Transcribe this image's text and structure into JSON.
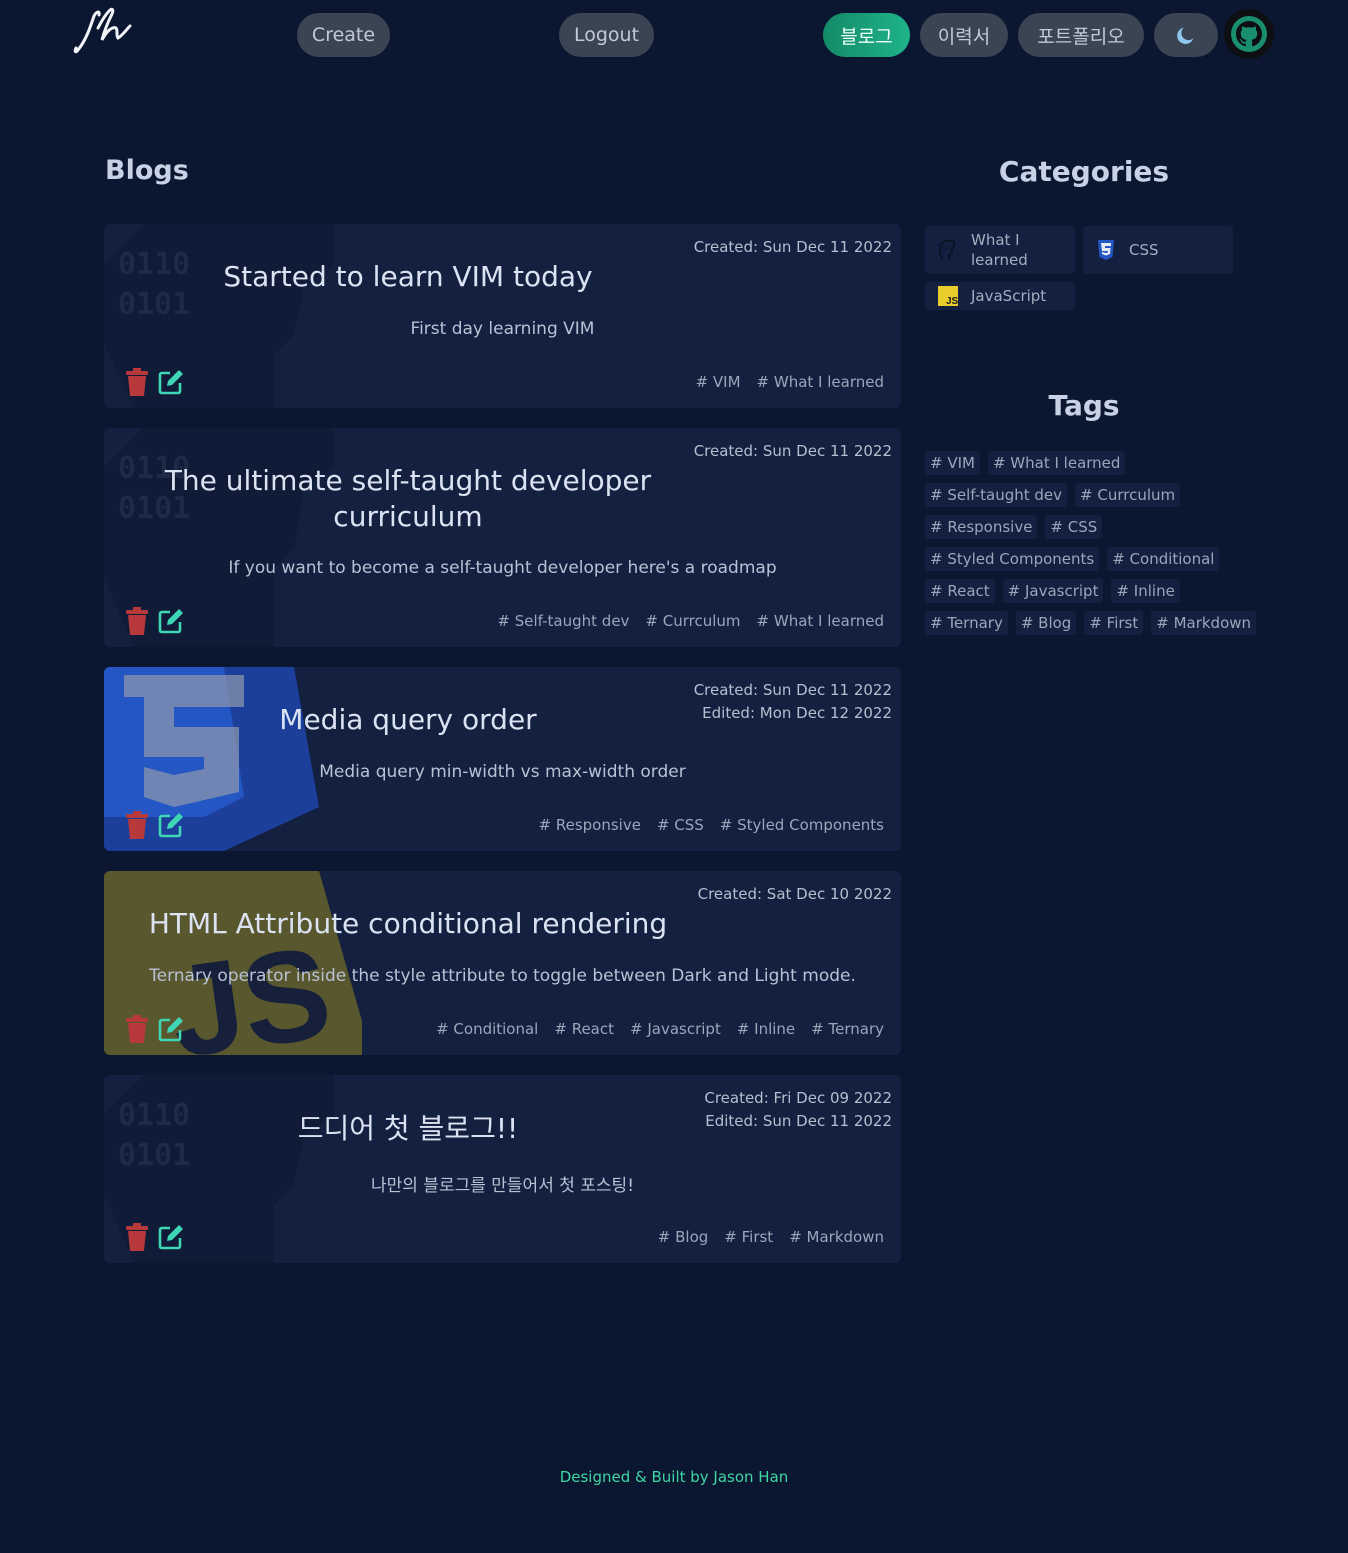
{
  "nav": {
    "logo_text": "jh",
    "create_label": "Create",
    "logout_label": "Logout",
    "blog_label": "블로그",
    "resume_label": "이력서",
    "portfolio_label": "포트폴리오",
    "theme_icon": "moon-icon",
    "github_icon": "github-icon"
  },
  "main": {
    "heading": "Blogs",
    "posts": [
      {
        "created": "Created: Sun Dec 11 2022",
        "edited": "",
        "title": "Started to learn VIM today",
        "excerpt": "First day learning VIM",
        "tags": [
          "VIM",
          "What I learned"
        ],
        "bg_icon": "binary-brain-icon"
      },
      {
        "created": "Created: Sun Dec 11 2022",
        "edited": "",
        "title": "The ultimate self-taught developer curriculum",
        "excerpt": "If you want to become a self-taught developer here's a roadmap",
        "tags": [
          "Self-taught dev",
          "Currculum",
          "What I learned"
        ],
        "bg_icon": "binary-brain-icon"
      },
      {
        "created": "Created: Sun Dec 11 2022",
        "edited": "Edited: Mon Dec 12 2022",
        "title": "Media query order",
        "excerpt": "Media query min-width vs max-width order",
        "tags": [
          "Responsive",
          "CSS",
          "Styled Components"
        ],
        "bg_icon": "css3-icon"
      },
      {
        "created": "Created: Sat Dec 10 2022",
        "edited": "",
        "title": "HTML Attribute conditional rendering",
        "excerpt": "Ternary operator inside the style attribute to toggle between Dark and Light mode.",
        "tags": [
          "Conditional",
          "React",
          "Javascript",
          "Inline",
          "Ternary"
        ],
        "bg_icon": "javascript-icon"
      },
      {
        "created": "Created: Fri Dec 09 2022",
        "edited": "Edited: Sun Dec 11 2022",
        "title": "드디어 첫 블로그!!",
        "excerpt": "나만의 블로그를 만들어서 첫 포스팅!",
        "tags": [
          "Blog",
          "First",
          "Markdown"
        ],
        "bg_icon": "binary-brain-icon"
      }
    ]
  },
  "sidebar": {
    "categories_heading": "Categories",
    "categories": [
      {
        "label": "What I learned",
        "icon": "binary-brain-icon"
      },
      {
        "label": "CSS",
        "icon": "css3-icon"
      },
      {
        "label": "JavaScript",
        "icon": "javascript-icon"
      }
    ],
    "tags_heading": "Tags",
    "tags": [
      [
        "VIM",
        "What I learned"
      ],
      [
        "Self-taught dev",
        "Currculum"
      ],
      [
        "Responsive",
        "CSS"
      ],
      [
        "Styled Components",
        "Conditional"
      ],
      [
        "React",
        "Javascript",
        "Inline"
      ],
      [
        "Ternary",
        "Blog",
        "First",
        "Markdown"
      ]
    ]
  },
  "footer": {
    "text": "Designed & Built by Jason Han"
  },
  "colors": {
    "background": "#0b1730",
    "card": "#13203f",
    "accent": "#1fb38a",
    "delete": "#b8393b",
    "edit": "#3fd6b6"
  }
}
